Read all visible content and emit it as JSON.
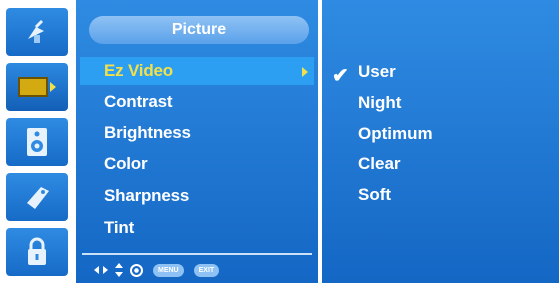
{
  "menu": {
    "title": "Picture",
    "items": [
      {
        "label": "Ez Video"
      },
      {
        "label": "Contrast"
      },
      {
        "label": "Brightness"
      },
      {
        "label": "Color"
      },
      {
        "label": "Sharpness"
      },
      {
        "label": "Tint"
      }
    ],
    "selected_index": 0
  },
  "rail": {
    "icons": [
      "satellite-dish-icon",
      "picture-icon",
      "audio-speaker-icon",
      "tag-icon",
      "lock-icon"
    ],
    "active_index": 1
  },
  "options": {
    "items": [
      "User",
      "Night",
      "Optimum",
      "Clear",
      "Soft"
    ],
    "checked_index": 0,
    "check_glyph": "✔"
  },
  "help_bar": {
    "icons": [
      "left-right-arrows-icon",
      "up-down-arrows-icon",
      "ok-button-icon",
      "menu-key-icon",
      "exit-key-icon"
    ],
    "menu_key": "MENU",
    "exit_key": "EXIT"
  },
  "colors": {
    "panel": "#1f7ad6",
    "selected_row": "#2d9ff2",
    "selected_text": "#f2e04a",
    "text": "#ffffff"
  }
}
